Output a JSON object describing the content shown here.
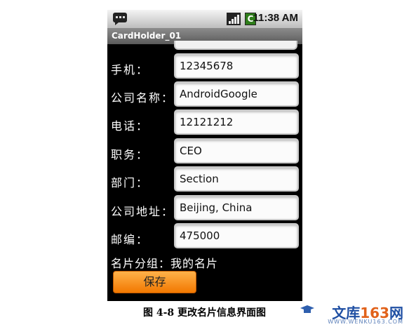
{
  "status_bar": {
    "time": "11:38",
    "ampm": "AM",
    "battery_glyph": "C"
  },
  "app": {
    "title": "CardHolder_01"
  },
  "form": {
    "rows": [
      {
        "label": "手机：",
        "value": "12345678"
      },
      {
        "label": "公司名称：",
        "value": "AndroidGoogle"
      },
      {
        "label": "电话：",
        "value": "12121212"
      },
      {
        "label": "职务：",
        "value": "CEO"
      },
      {
        "label": "部门：",
        "value": "Section"
      },
      {
        "label": "公司地址：",
        "value": "Beijing, China"
      },
      {
        "label": "邮编：",
        "value": "475000"
      }
    ],
    "group_label": "名片分组：",
    "group_value": "我的名片",
    "save_label": "保存"
  },
  "caption": "图 4-8 更改名片信息界面图",
  "watermark": {
    "brand_text": "文库",
    "brand_num": "163",
    "brand_suffix": "网",
    "url": "WWW.WENKU163.COM"
  },
  "colors": {
    "accent_button": "#f27800",
    "background": "#000000",
    "watermark_blue": "#1f4fa3",
    "watermark_orange": "#e1621b"
  }
}
